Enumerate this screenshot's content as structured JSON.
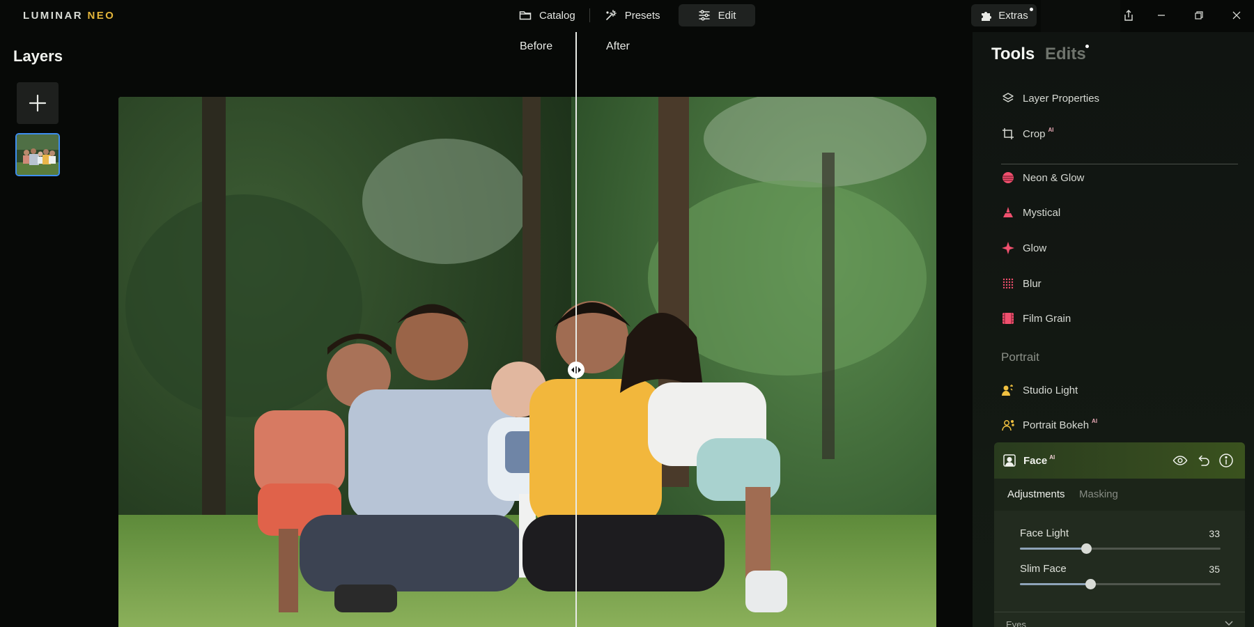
{
  "app": {
    "logo_main": "LUMINAR",
    "logo_accent": "NEO"
  },
  "nav": {
    "catalog": "Catalog",
    "presets": "Presets",
    "edit": "Edit",
    "extras": "Extras"
  },
  "layers": {
    "title": "Layers"
  },
  "compare": {
    "before": "Before",
    "after": "After",
    "split_fraction": 0.5
  },
  "panel": {
    "tab_tools": "Tools",
    "tab_edits": "Edits",
    "tools": [
      {
        "label": "Layer Properties",
        "icon": "layers-icon",
        "ai": ""
      },
      {
        "label": "Crop",
        "icon": "crop-icon",
        "ai": "AI"
      },
      {
        "label": "Neon & Glow",
        "icon": "neon-glow-icon",
        "ai": ""
      },
      {
        "label": "Mystical",
        "icon": "mystical-icon",
        "ai": ""
      },
      {
        "label": "Glow",
        "icon": "glow-sparkle-icon",
        "ai": ""
      },
      {
        "label": "Blur",
        "icon": "blur-grid-icon",
        "ai": ""
      },
      {
        "label": "Film Grain",
        "icon": "film-icon",
        "ai": ""
      }
    ],
    "portrait_section": "Portrait",
    "portrait_tools": [
      {
        "label": "Studio Light",
        "icon": "studio-light-icon",
        "ai": ""
      },
      {
        "label": "Portrait Bokeh",
        "icon": "portrait-bokeh-icon",
        "ai": "AI"
      }
    ],
    "face": {
      "title": "Face",
      "ai": "AI",
      "tab_adjustments": "Adjustments",
      "tab_masking": "Masking",
      "sliders": [
        {
          "label": "Face Light",
          "value": "33",
          "fraction": 0.33
        },
        {
          "label": "Slim Face",
          "value": "35",
          "fraction": 0.35
        }
      ],
      "next_section": "Eyes"
    }
  },
  "colors": {
    "accent_blue": "#3e8ef0",
    "logo_neo": "#e3b53a",
    "tool_pink": "#f0506e",
    "studio_light_yellow": "#f0c040",
    "face_header_green": "#34491f"
  }
}
